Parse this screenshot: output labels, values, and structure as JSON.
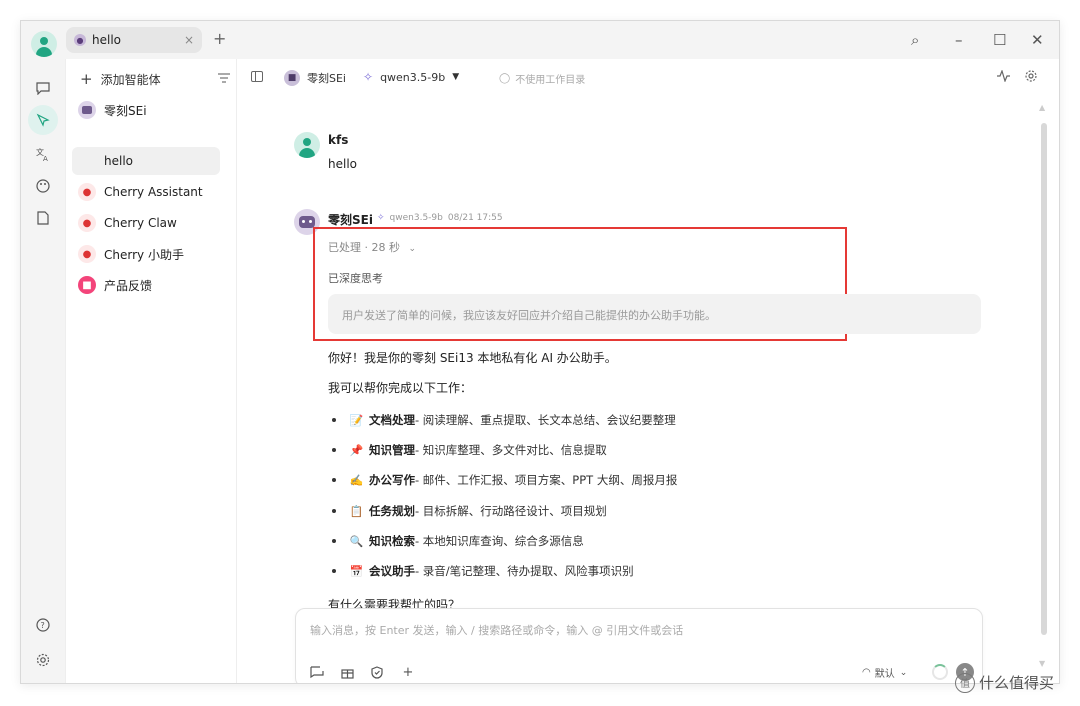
{
  "titlebar": {
    "tab_label": "hello",
    "tab_close": "×",
    "tab_add": "+",
    "search": "⌕",
    "minimize": "–",
    "maximize": "☐",
    "close": "✕"
  },
  "rail": {
    "icons": [
      "chat-icon",
      "agent-icon",
      "translate-icon",
      "palette-icon",
      "files-icon",
      "help-icon",
      "settings-icon"
    ]
  },
  "sidebar": {
    "add_label": "添加智能体",
    "items": [
      {
        "label": "零刻SEi",
        "selected": false
      },
      {
        "label": "hello",
        "selected": true
      },
      {
        "label": "Cherry Assistant",
        "selected": false
      },
      {
        "label": "Cherry Claw",
        "selected": false
      },
      {
        "label": "Cherry 小助手",
        "selected": false
      },
      {
        "label": "产品反馈",
        "selected": false
      }
    ]
  },
  "toolbar": {
    "agent_name": "零刻SEi",
    "model_name": "qwen3.5-9b",
    "workdir_label": "不使用工作目录"
  },
  "messages": {
    "user": {
      "name": "kfs",
      "text": "hello"
    },
    "bot": {
      "name": "零刻SEi",
      "model": "qwen3.5-9b",
      "time": "08/21 17:55",
      "processed": "已处理 · 28 秒",
      "deep_thought": "已深度思考",
      "thought_text": "用户发送了简单的问候，我应该友好回应并介绍自己能提供的办公助手功能。",
      "intro": "你好！我是你的零刻 SEi13 本地私有化 AI 办公助手。",
      "can_help": "我可以帮你完成以下工作：",
      "list": [
        {
          "emoji": "📝",
          "title": "文档处理",
          "desc": " - 阅读理解、重点提取、长文本总结、会议纪要整理"
        },
        {
          "emoji": "📌",
          "title": "知识管理",
          "desc": " - 知识库整理、多文件对比、信息提取"
        },
        {
          "emoji": "✍️",
          "title": "办公写作",
          "desc": " - 邮件、工作汇报、项目方案、PPT 大纲、周报月报"
        },
        {
          "emoji": "📋",
          "title": "任务规划",
          "desc": " - 目标拆解、行动路径设计、项目规划"
        },
        {
          "emoji": "🔍",
          "title": "知识检索",
          "desc": " - 本地知识库查询、综合多源信息"
        },
        {
          "emoji": "📅",
          "title": "会议助手",
          "desc": " - 录音/笔记整理、待办提取、风险事项识别"
        }
      ],
      "closing": "有什么需要我帮忙的吗？"
    }
  },
  "input": {
    "placeholder": "输入消息，按 Enter 发送，输入 / 搜索路径或命令，输入 @ 引用文件或会话",
    "mode_label": "默认",
    "send": "↑"
  },
  "watermark": "什么值得买"
}
